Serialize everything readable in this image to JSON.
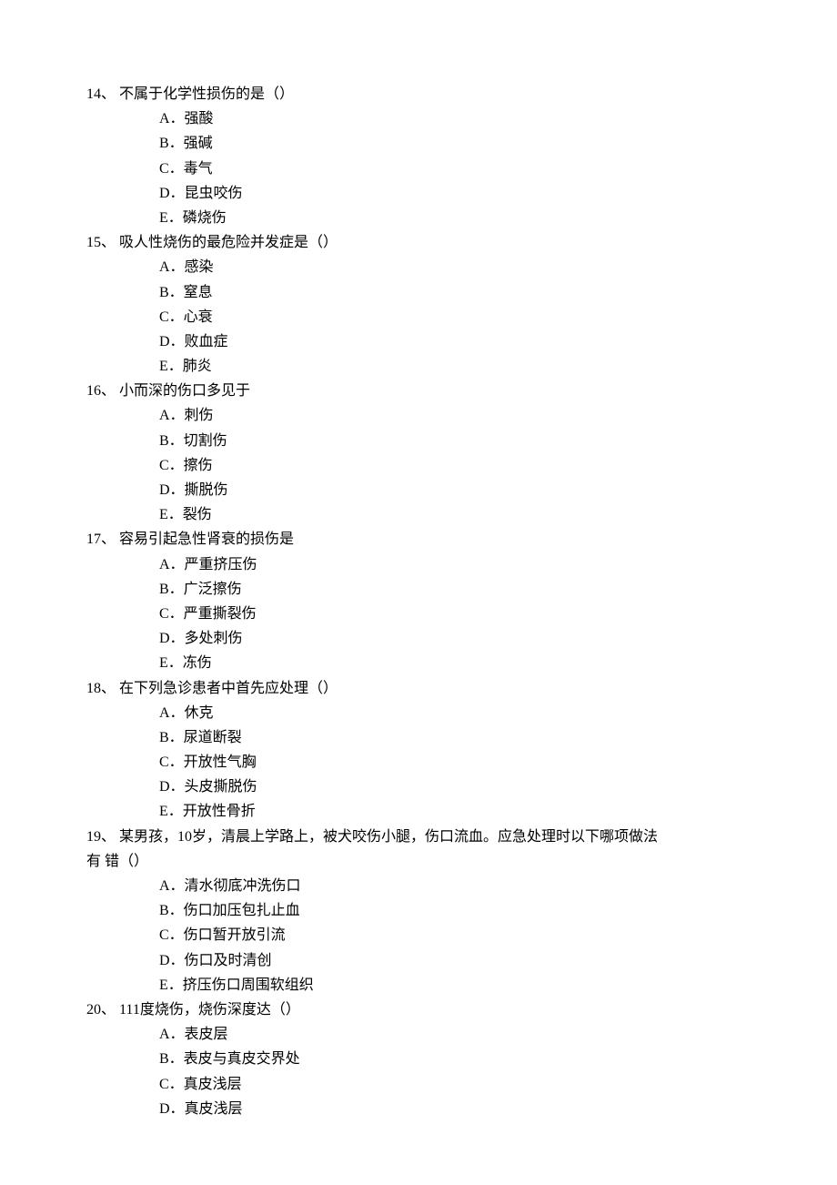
{
  "questions": [
    {
      "number": "14、",
      "stem": "不属于化学性损伤的是（）",
      "options": [
        "A．强酸",
        "B．强碱",
        "C．毒气",
        "D．昆虫咬伤",
        "E．磷烧伤"
      ]
    },
    {
      "number": "15、",
      "stem": "吸人性烧伤的最危险并发症是（）",
      "options": [
        "A．感染",
        "B．窒息",
        "C．心衰",
        "D．败血症",
        "E．肺炎"
      ]
    },
    {
      "number": "16、",
      "stem": "小而深的伤口多见于",
      "options": [
        "A．刺伤",
        "B．切割伤",
        "C．擦伤",
        "D．撕脱伤",
        "E．裂伤"
      ]
    },
    {
      "number": "17、",
      "stem": "容易引起急性肾衰的损伤是",
      "options": [
        "A．严重挤压伤",
        "B．广泛擦伤",
        "C．严重撕裂伤",
        "D．多处刺伤",
        "E．冻伤"
      ]
    },
    {
      "number": "18、",
      "stem": "在下列急诊患者中首先应处理（）",
      "options": [
        "A．休克",
        "B．尿道断裂",
        "C．开放性气胸",
        "D．头皮撕脱伤",
        "E．开放性骨折"
      ]
    },
    {
      "number": "19、",
      "stem": "某男孩，10岁，清晨上学路上，被犬咬伤小腿，伤口流血。应急处理时以下哪项做法",
      "stem_line2": "有 错（）",
      "options": [
        "A．清水彻底冲洗伤口",
        "B．伤口加压包扎止血",
        "C．伤口暂开放引流",
        "D．伤口及时清创",
        "E．挤压伤口周围软组织"
      ]
    },
    {
      "number": "20、",
      "stem": "111度烧伤，烧伤深度达（）",
      "options": [
        "A．表皮层",
        "B．表皮与真皮交界处",
        "C．真皮浅层",
        "D．真皮浅层"
      ]
    }
  ]
}
